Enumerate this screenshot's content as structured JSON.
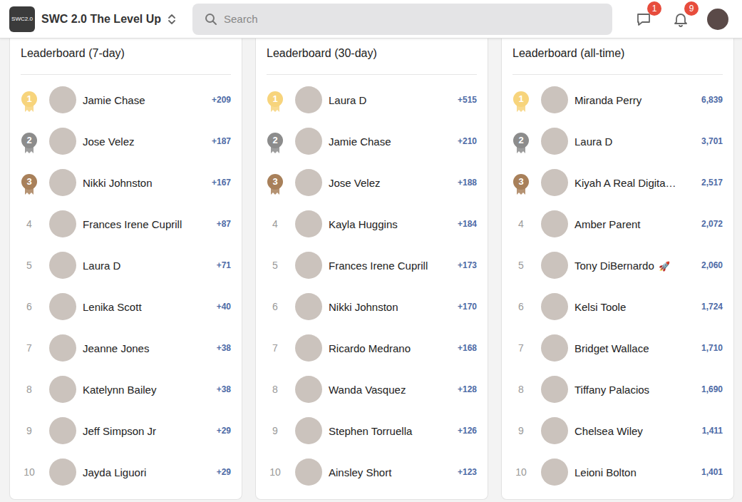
{
  "header": {
    "logo": "SWC2.0",
    "title": "SWC 2.0 The Level Up",
    "search": {
      "placeholder": "Search"
    },
    "messages_badge": "1",
    "notifications_badge": "9"
  },
  "leaderboards": [
    {
      "title": "Leaderboard (7-day)",
      "entries": [
        {
          "rank": "1",
          "name": "Jamie Chase",
          "points": "+209",
          "kind": "medal",
          "color": "#f7d47c"
        },
        {
          "rank": "2",
          "name": "Jose Velez",
          "points": "+187",
          "kind": "medal",
          "color": "#8c8c8c"
        },
        {
          "rank": "3",
          "name": "Nikki Johnston",
          "points": "+167",
          "kind": "medal",
          "color": "#a8805a"
        },
        {
          "rank": "4",
          "name": "Frances Irene Cuprill",
          "points": "+87",
          "kind": "plain"
        },
        {
          "rank": "5",
          "name": "Laura D",
          "points": "+71",
          "kind": "plain"
        },
        {
          "rank": "6",
          "name": "Lenika Scott",
          "points": "+40",
          "kind": "plain"
        },
        {
          "rank": "7",
          "name": "Jeanne Jones",
          "points": "+38",
          "kind": "plain"
        },
        {
          "rank": "8",
          "name": "Katelynn Bailey",
          "points": "+38",
          "kind": "plain"
        },
        {
          "rank": "9",
          "name": "Jeff Simpson Jr",
          "points": "+29",
          "kind": "plain"
        },
        {
          "rank": "10",
          "name": "Jayda Liguori",
          "points": "+29",
          "kind": "plain"
        }
      ]
    },
    {
      "title": "Leaderboard (30-day)",
      "entries": [
        {
          "rank": "1",
          "name": "Laura D",
          "points": "+515",
          "kind": "medal",
          "color": "#f7d47c"
        },
        {
          "rank": "2",
          "name": "Jamie Chase",
          "points": "+210",
          "kind": "medal",
          "color": "#8c8c8c"
        },
        {
          "rank": "3",
          "name": "Jose Velez",
          "points": "+188",
          "kind": "medal",
          "color": "#a8805a"
        },
        {
          "rank": "4",
          "name": "Kayla Huggins",
          "points": "+184",
          "kind": "plain"
        },
        {
          "rank": "5",
          "name": "Frances Irene Cuprill",
          "points": "+173",
          "kind": "plain"
        },
        {
          "rank": "6",
          "name": "Nikki Johnston",
          "points": "+170",
          "kind": "plain"
        },
        {
          "rank": "7",
          "name": "Ricardo Medrano",
          "points": "+168",
          "kind": "plain"
        },
        {
          "rank": "8",
          "name": "Wanda Vasquez",
          "points": "+128",
          "kind": "plain"
        },
        {
          "rank": "9",
          "name": "Stephen Torruella",
          "points": "+126",
          "kind": "plain"
        },
        {
          "rank": "10",
          "name": "Ainsley Short",
          "points": "+123",
          "kind": "plain"
        }
      ]
    },
    {
      "title": "Leaderboard (all-time)",
      "entries": [
        {
          "rank": "1",
          "name": "Miranda Perry",
          "points": "6,839",
          "kind": "medal",
          "color": "#f7d47c"
        },
        {
          "rank": "2",
          "name": "Laura D",
          "points": "3,701",
          "kind": "medal",
          "color": "#8c8c8c"
        },
        {
          "rank": "3",
          "name": "Kiyah A Real Digita…",
          "points": "2,517",
          "kind": "medal",
          "color": "#a8805a"
        },
        {
          "rank": "4",
          "name": "Amber Parent",
          "points": "2,072",
          "kind": "plain"
        },
        {
          "rank": "5",
          "name": "Tony DiBernardo",
          "emoji": "🚀",
          "points": "2,060",
          "kind": "plain"
        },
        {
          "rank": "6",
          "name": "Kelsi Toole",
          "points": "1,724",
          "kind": "plain"
        },
        {
          "rank": "7",
          "name": "Bridget Wallace",
          "points": "1,710",
          "kind": "plain"
        },
        {
          "rank": "8",
          "name": "Tiffany Palacios",
          "points": "1,690",
          "kind": "plain"
        },
        {
          "rank": "9",
          "name": "Chelsea Wiley",
          "points": "1,411",
          "kind": "plain"
        },
        {
          "rank": "10",
          "name": "Leioni Bolton",
          "points": "1,401",
          "kind": "plain"
        }
      ]
    }
  ]
}
